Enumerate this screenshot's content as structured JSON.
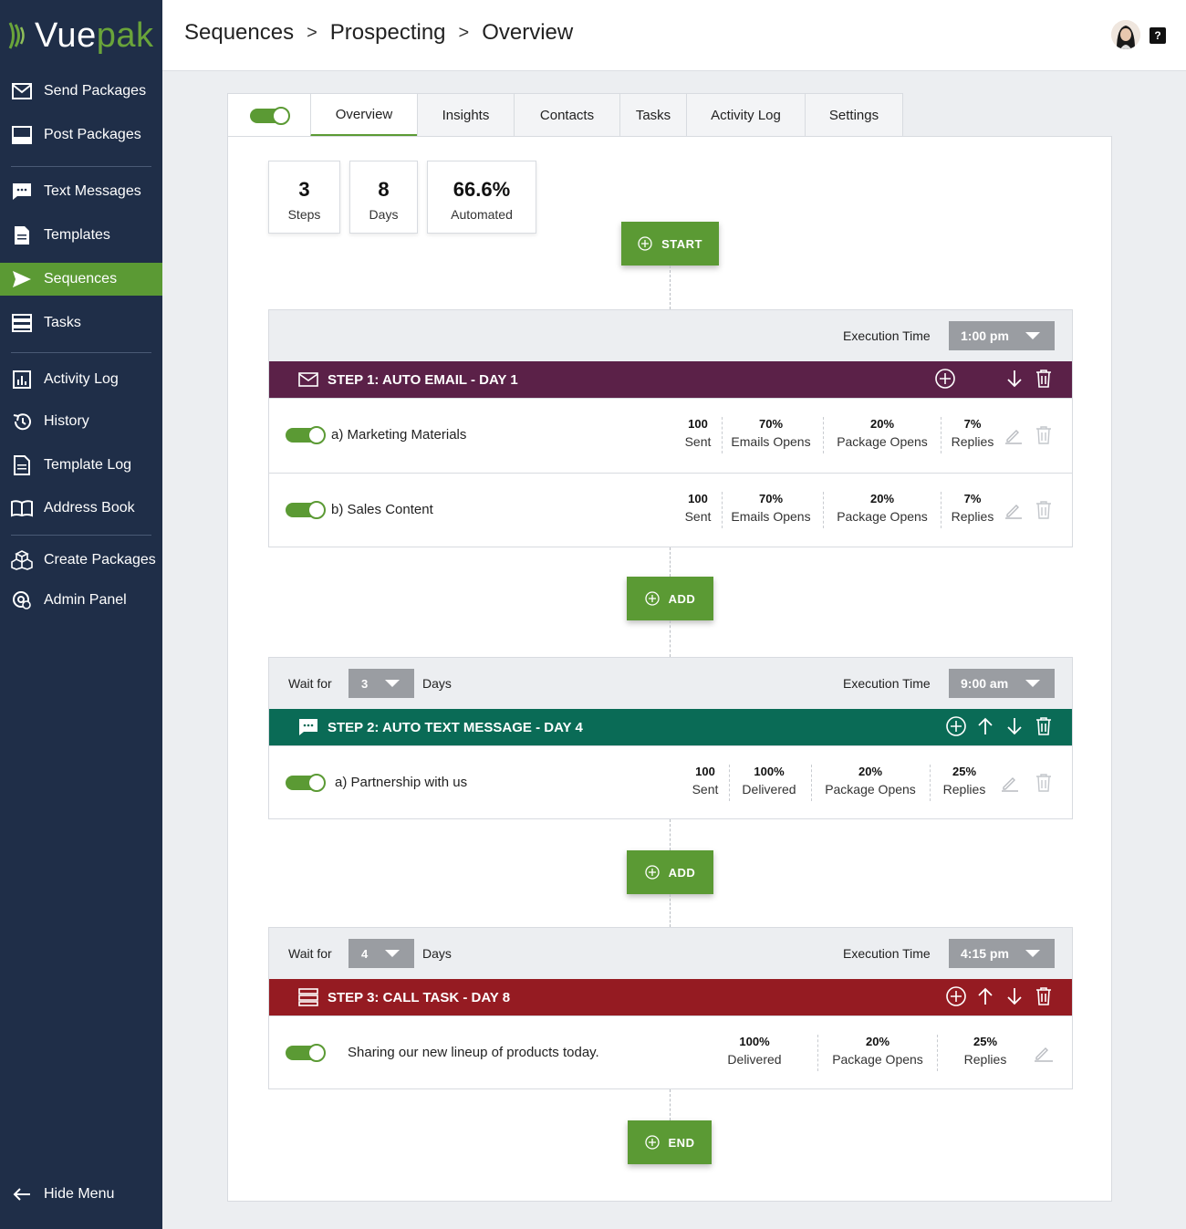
{
  "brand": {
    "name_part1": "Vue",
    "name_part2": "pak",
    "accent": "#5b9a34",
    "sidebar_bg": "#1f2e48"
  },
  "sidebar": {
    "items": [
      {
        "label": "Send Packages",
        "icon": "envelope-icon"
      },
      {
        "label": "Post Packages",
        "icon": "inbox-icon"
      },
      {
        "label": "Text Messages",
        "icon": "chat-icon"
      },
      {
        "label": "Templates",
        "icon": "document-icon"
      },
      {
        "label": "Sequences",
        "icon": "send-icon",
        "active": true
      },
      {
        "label": "Tasks",
        "icon": "tasks-icon"
      },
      {
        "label": "Activity Log",
        "icon": "chart-icon"
      },
      {
        "label": "History",
        "icon": "history-icon"
      },
      {
        "label": "Template Log",
        "icon": "document-icon"
      },
      {
        "label": "Address Book",
        "icon": "book-icon"
      },
      {
        "label": "Create Packages",
        "icon": "boxes-icon"
      },
      {
        "label": "Admin Panel",
        "icon": "admin-icon"
      }
    ],
    "hide_menu": "Hide Menu"
  },
  "header": {
    "breadcrumbs": [
      "Sequences",
      "Prospecting",
      "Overview"
    ],
    "separator": ">",
    "help": "?"
  },
  "tabs": [
    "Overview",
    "Insights",
    "Contacts",
    "Tasks",
    "Activity Log",
    "Settings"
  ],
  "stats": [
    {
      "value": "3",
      "label": "Steps"
    },
    {
      "value": "8",
      "label": "Days"
    },
    {
      "value": "66.6%",
      "label": "Automated"
    }
  ],
  "buttons": {
    "start": "START",
    "add": "ADD",
    "end": "END"
  },
  "labels": {
    "execution_time": "Execution Time",
    "wait_for": "Wait for",
    "days": "Days"
  },
  "steps": [
    {
      "title": "STEP 1: AUTO EMAIL - DAY 1",
      "color": "#5b2148",
      "exec_time": "1:00 pm",
      "rows": [
        {
          "label": "a) Marketing Materials",
          "metrics": [
            [
              "100",
              "Sent"
            ],
            [
              "70%",
              "Emails Opens"
            ],
            [
              "20%",
              "Package Opens"
            ],
            [
              "7%",
              "Replies"
            ]
          ]
        },
        {
          "label": "b) Sales Content",
          "metrics": [
            [
              "100",
              "Sent"
            ],
            [
              "70%",
              "Emails Opens"
            ],
            [
              "20%",
              "Package Opens"
            ],
            [
              "7%",
              "Replies"
            ]
          ]
        }
      ]
    },
    {
      "title": "STEP 2: AUTO TEXT MESSAGE - DAY 4",
      "color": "#0a6b56",
      "wait": "3",
      "exec_time": "9:00 am",
      "rows": [
        {
          "label": "a) Partnership with us",
          "metrics": [
            [
              "100",
              "Sent"
            ],
            [
              "100%",
              "Delivered"
            ],
            [
              "20%",
              "Package Opens"
            ],
            [
              "25%",
              "Replies"
            ]
          ]
        }
      ]
    },
    {
      "title": "STEP 3: CALL TASK - DAY 8",
      "color": "#951b22",
      "wait": "4",
      "exec_time": "4:15 pm",
      "rows": [
        {
          "label": "Sharing our new lineup of products today.",
          "metrics": [
            [
              "100%",
              "Delivered"
            ],
            [
              "20%",
              "Package Opens"
            ],
            [
              "25%",
              "Replies"
            ]
          ]
        }
      ]
    }
  ]
}
